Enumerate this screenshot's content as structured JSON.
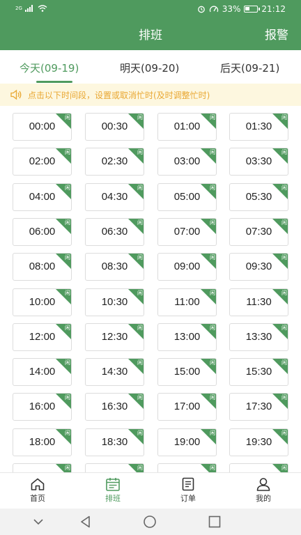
{
  "status_bar": {
    "network": "2G",
    "battery": "33%",
    "battery_level": 0.33,
    "time": "21:12"
  },
  "header": {
    "title": "排班",
    "alarm_label": "报警",
    "bg_color": "#4f9a5e"
  },
  "tabs": [
    {
      "label": "今天(09-19)",
      "active": true
    },
    {
      "label": "明天(09-20)",
      "active": false
    },
    {
      "label": "后天(09-21)",
      "active": false
    }
  ],
  "notice": {
    "icon": "speaker-icon",
    "text": "点击以下时间段，设置或取消忙时(及时调整忙时)"
  },
  "slots": [
    {
      "time": "00:00",
      "badge": "闲"
    },
    {
      "time": "00:30",
      "badge": "闲"
    },
    {
      "time": "01:00",
      "badge": "闲"
    },
    {
      "time": "01:30",
      "badge": "闲"
    },
    {
      "time": "02:00",
      "badge": "闲"
    },
    {
      "time": "02:30",
      "badge": "闲"
    },
    {
      "time": "03:00",
      "badge": "闲"
    },
    {
      "time": "03:30",
      "badge": "闲"
    },
    {
      "time": "04:00",
      "badge": "闲"
    },
    {
      "time": "04:30",
      "badge": "闲"
    },
    {
      "time": "05:00",
      "badge": "闲"
    },
    {
      "time": "05:30",
      "badge": "闲"
    },
    {
      "time": "06:00",
      "badge": "闲"
    },
    {
      "time": "06:30",
      "badge": "闲"
    },
    {
      "time": "07:00",
      "badge": "闲"
    },
    {
      "time": "07:30",
      "badge": "闲"
    },
    {
      "time": "08:00",
      "badge": "闲"
    },
    {
      "time": "08:30",
      "badge": "闲"
    },
    {
      "time": "09:00",
      "badge": "闲"
    },
    {
      "time": "09:30",
      "badge": "闲"
    },
    {
      "time": "10:00",
      "badge": "闲"
    },
    {
      "time": "10:30",
      "badge": "闲"
    },
    {
      "time": "11:00",
      "badge": "闲"
    },
    {
      "time": "11:30",
      "badge": "闲"
    },
    {
      "time": "12:00",
      "badge": "闲"
    },
    {
      "time": "12:30",
      "badge": "闲"
    },
    {
      "time": "13:00",
      "badge": "闲"
    },
    {
      "time": "13:30",
      "badge": "闲"
    },
    {
      "time": "14:00",
      "badge": "闲"
    },
    {
      "time": "14:30",
      "badge": "闲"
    },
    {
      "time": "15:00",
      "badge": "闲"
    },
    {
      "time": "15:30",
      "badge": "闲"
    },
    {
      "time": "16:00",
      "badge": "闲"
    },
    {
      "time": "16:30",
      "badge": "闲"
    },
    {
      "time": "17:00",
      "badge": "闲"
    },
    {
      "time": "17:30",
      "badge": "闲"
    },
    {
      "time": "18:00",
      "badge": "闲"
    },
    {
      "time": "18:30",
      "badge": "闲"
    },
    {
      "time": "19:00",
      "badge": "闲"
    },
    {
      "time": "19:30",
      "badge": "闲"
    },
    {
      "time": "",
      "badge": "闲"
    },
    {
      "time": "",
      "badge": "闲"
    },
    {
      "time": "",
      "badge": "闲"
    },
    {
      "time": "",
      "badge": "闲"
    }
  ],
  "bottom_nav": [
    {
      "label": "首页",
      "icon": "home-icon",
      "active": false
    },
    {
      "label": "排班",
      "icon": "calendar-icon",
      "active": true
    },
    {
      "label": "订单",
      "icon": "order-list-icon",
      "active": false
    },
    {
      "label": "我的",
      "icon": "user-icon",
      "active": false
    }
  ],
  "colors": {
    "accent": "#4f9a5e",
    "notice_text": "#e9a732",
    "notice_bg": "#fdf7df"
  }
}
